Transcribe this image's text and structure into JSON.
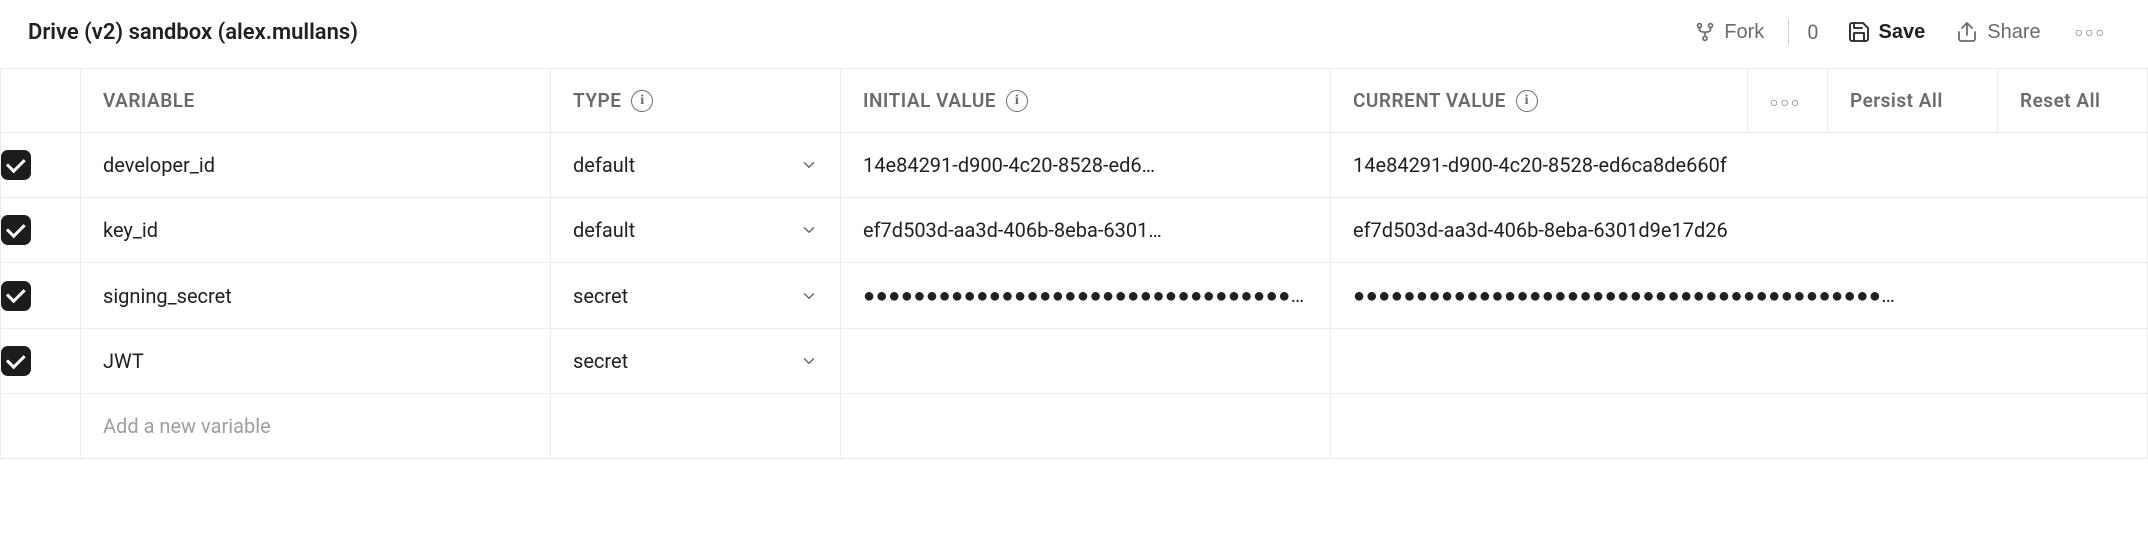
{
  "header": {
    "title": "Drive (v2) sandbox (alex.mullans)",
    "fork_label": "Fork",
    "fork_count": "0",
    "save_label": "Save",
    "share_label": "Share"
  },
  "columns": {
    "variable": "VARIABLE",
    "type": "TYPE",
    "initial_value": "INITIAL VALUE",
    "current_value": "CURRENT VALUE",
    "persist_all": "Persist All",
    "reset_all": "Reset All"
  },
  "rows": [
    {
      "checked": true,
      "variable": "developer_id",
      "type": "default",
      "initial_display": "14e84291-d900-4c20-8528-ed6…",
      "initial_full": "14e84291-d900-4c20-8528-ed6ca8de660f",
      "current": "14e84291-d900-4c20-8528-ed6ca8de660f"
    },
    {
      "checked": true,
      "variable": "key_id",
      "type": "default",
      "initial_display": "ef7d503d-aa3d-406b-8eba-6301…",
      "initial_full": "ef7d503d-aa3d-406b-8eba-6301d9e17d26",
      "current": "ef7d503d-aa3d-406b-8eba-6301d9e17d26"
    },
    {
      "checked": true,
      "variable": "signing_secret",
      "type": "secret",
      "initial_display": "●●●●●●●●●●●●●●●●●●●●●●●●●●●●●●●●●●…",
      "initial_full": "",
      "current": "●●●●●●●●●●●●●●●●●●●●●●●●●●●●●●●●●●●●●●●●●●…"
    },
    {
      "checked": true,
      "variable": "JWT",
      "type": "secret",
      "initial_display": "",
      "initial_full": "",
      "current": ""
    }
  ],
  "new_row_placeholder": "Add a new variable"
}
